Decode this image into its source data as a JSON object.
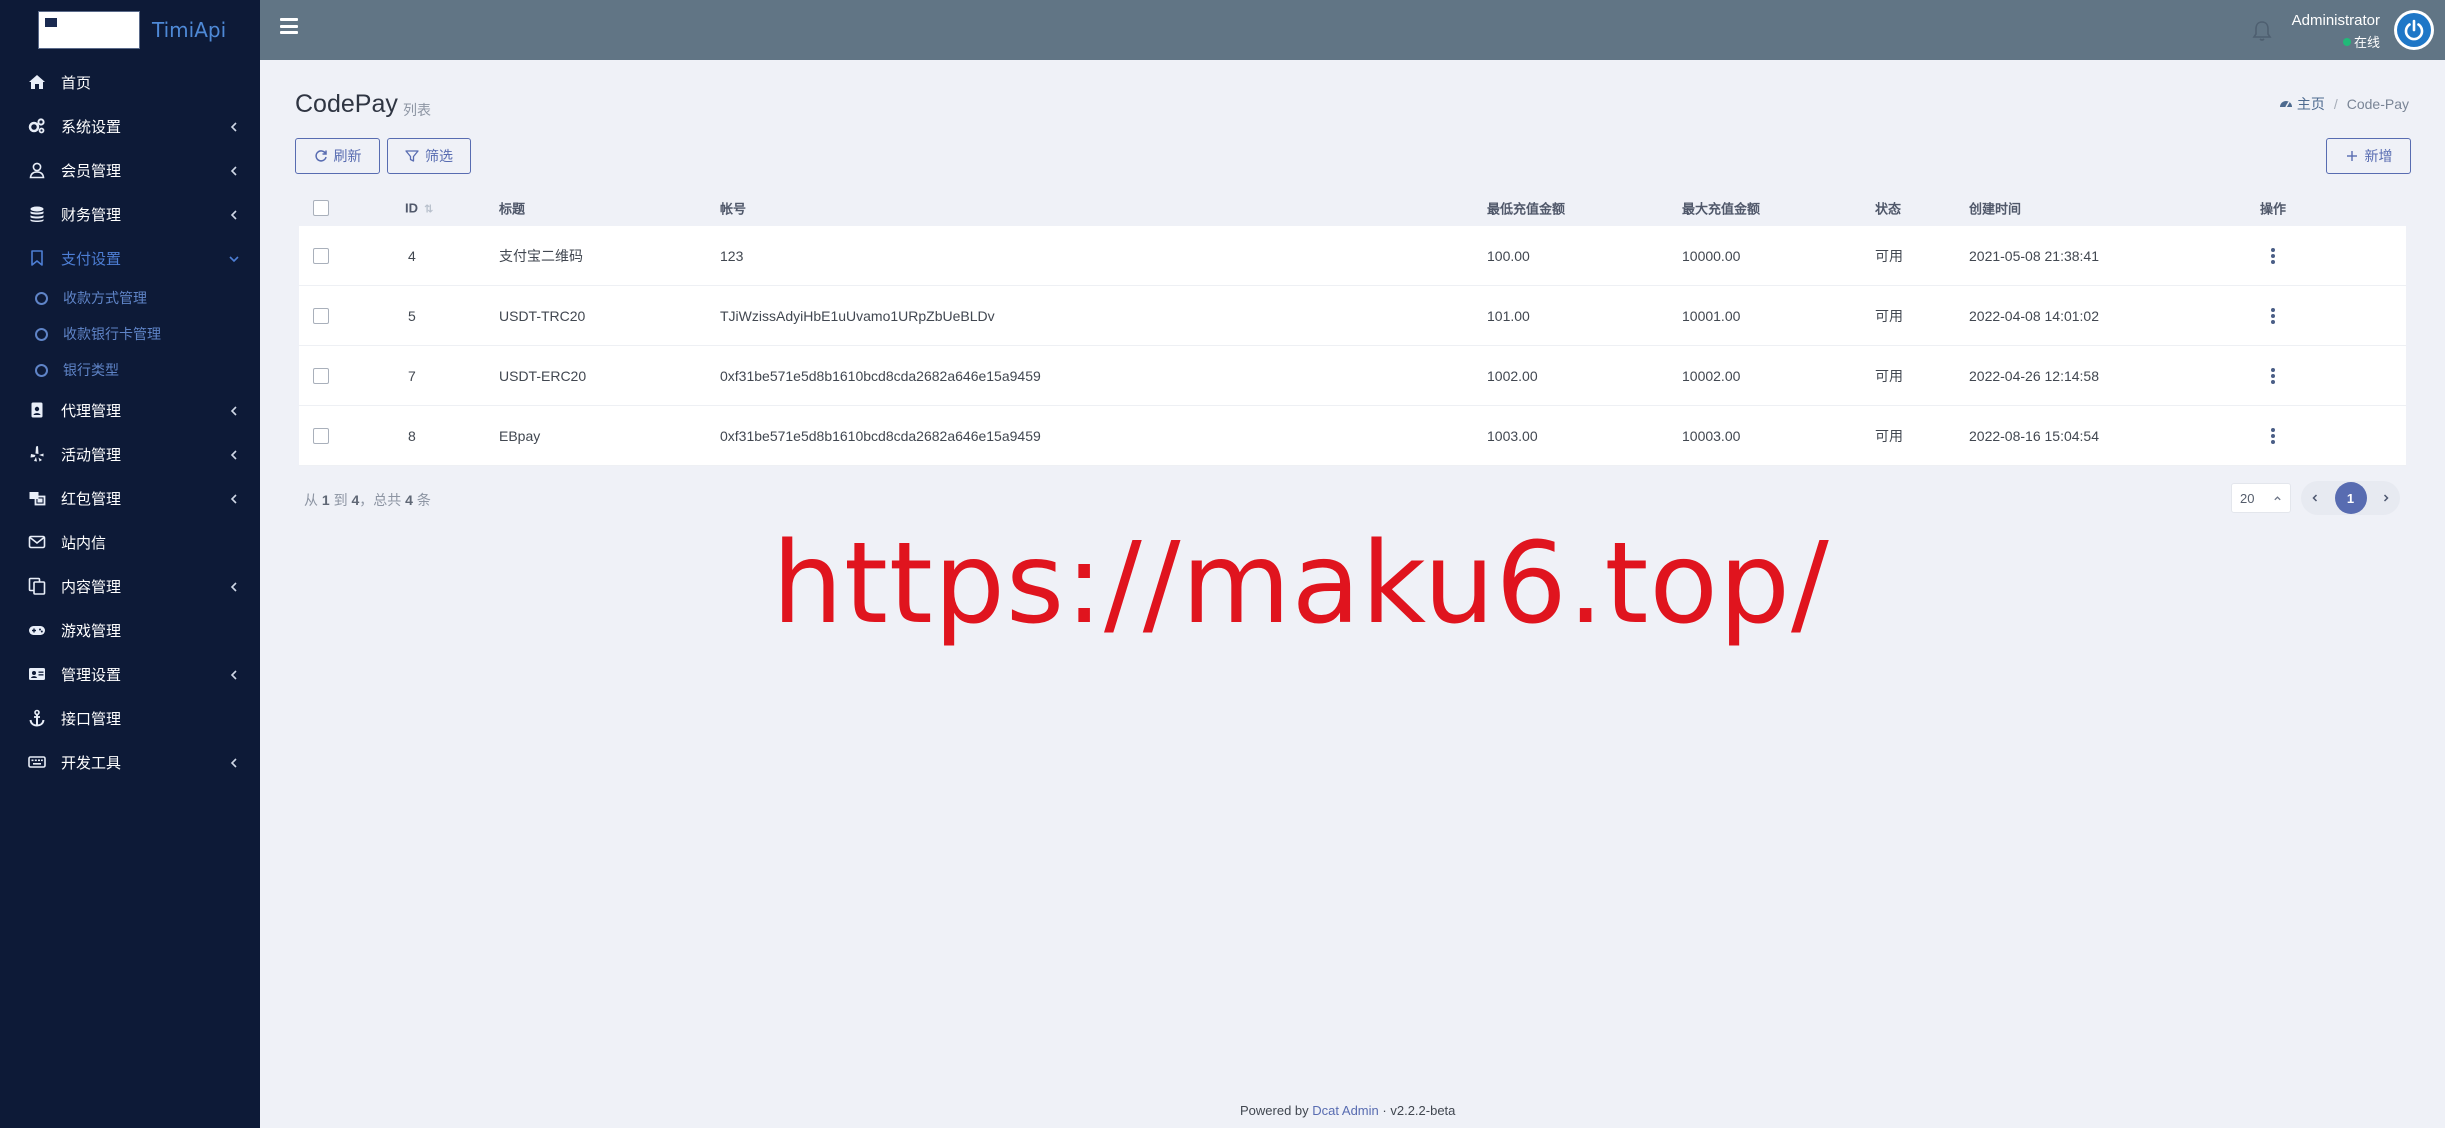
{
  "brand": {
    "name": "TimiApi"
  },
  "sidebar": {
    "items": [
      {
        "label": "首页",
        "icon": "home-icon",
        "has_caret": false
      },
      {
        "label": "系统设置",
        "icon": "gears-icon",
        "has_caret": true
      },
      {
        "label": "会员管理",
        "icon": "user-icon",
        "has_caret": true
      },
      {
        "label": "财务管理",
        "icon": "database-icon",
        "has_caret": true
      },
      {
        "label": "支付设置",
        "icon": "bookmark-icon",
        "has_caret": true,
        "open": true
      },
      {
        "label": "代理管理",
        "icon": "id-badge-icon",
        "has_caret": true
      },
      {
        "label": "活动管理",
        "icon": "yelp-icon",
        "has_caret": true
      },
      {
        "label": "红包管理",
        "icon": "object-group-icon",
        "has_caret": true
      },
      {
        "label": "站内信",
        "icon": "envelope-icon",
        "has_caret": false
      },
      {
        "label": "内容管理",
        "icon": "copy-icon",
        "has_caret": true
      },
      {
        "label": "游戏管理",
        "icon": "gamepad-icon",
        "has_caret": false
      },
      {
        "label": "管理设置",
        "icon": "address-card-icon",
        "has_caret": true
      },
      {
        "label": "接口管理",
        "icon": "anchor-icon",
        "has_caret": false
      },
      {
        "label": "开发工具",
        "icon": "keyboard-icon",
        "has_caret": true
      }
    ],
    "submenu": [
      {
        "label": "收款方式管理"
      },
      {
        "label": "收款银行卡管理"
      },
      {
        "label": "银行类型"
      }
    ]
  },
  "navbar": {
    "user_name": "Administrator",
    "user_status": "在线"
  },
  "page": {
    "title": "CodePay",
    "subtitle": "列表",
    "breadcrumb": {
      "home": "主页",
      "current": "Code-Pay"
    }
  },
  "toolbar": {
    "refresh_label": "刷新",
    "filter_label": "筛选",
    "new_label": "新增"
  },
  "table": {
    "columns": [
      "ID",
      "标题",
      "帐号",
      "最低充值金额",
      "最大充值金额",
      "状态",
      "创建时间",
      "操作"
    ],
    "rows": [
      {
        "id": "4",
        "title": "支付宝二维码",
        "account": "123",
        "min": "100.00",
        "max": "10000.00",
        "status": "可用",
        "created": "2021-05-08 21:38:41"
      },
      {
        "id": "5",
        "title": "USDT-TRC20",
        "account": "TJiWzissAdyiHbE1uUvamo1URpZbUeBLDv",
        "min": "101.00",
        "max": "10001.00",
        "status": "可用",
        "created": "2022-04-08 14:01:02"
      },
      {
        "id": "7",
        "title": "USDT-ERC20",
        "account": "0xf31be571e5d8b1610bcd8cda2682a646e15a9459",
        "min": "1002.00",
        "max": "10002.00",
        "status": "可用",
        "created": "2022-04-26 12:14:58"
      },
      {
        "id": "8",
        "title": "EBpay",
        "account": "0xf31be571e5d8b1610bcd8cda2682a646e15a9459",
        "min": "1003.00",
        "max": "10003.00",
        "status": "可用",
        "created": "2022-08-16 15:04:54"
      }
    ]
  },
  "pagination": {
    "summary_from": "从",
    "from": "1",
    "summary_to": "到",
    "to": "4",
    "summary_total_prefix": "，总共",
    "total": "4",
    "summary_unit": "条",
    "per_page": "20",
    "current_page": "1"
  },
  "watermark": {
    "text": "https://maku6.top/"
  },
  "footer": {
    "powered_by": "Powered by",
    "link": "Dcat Admin",
    "separator": "·",
    "version": "v2.2.2-beta"
  },
  "colors": {
    "sidebar_bg": "#0d1a37",
    "navbar_bg": "#617585",
    "accent": "#586cb1",
    "watermark": "#e0141e",
    "status_online": "#21b978"
  }
}
